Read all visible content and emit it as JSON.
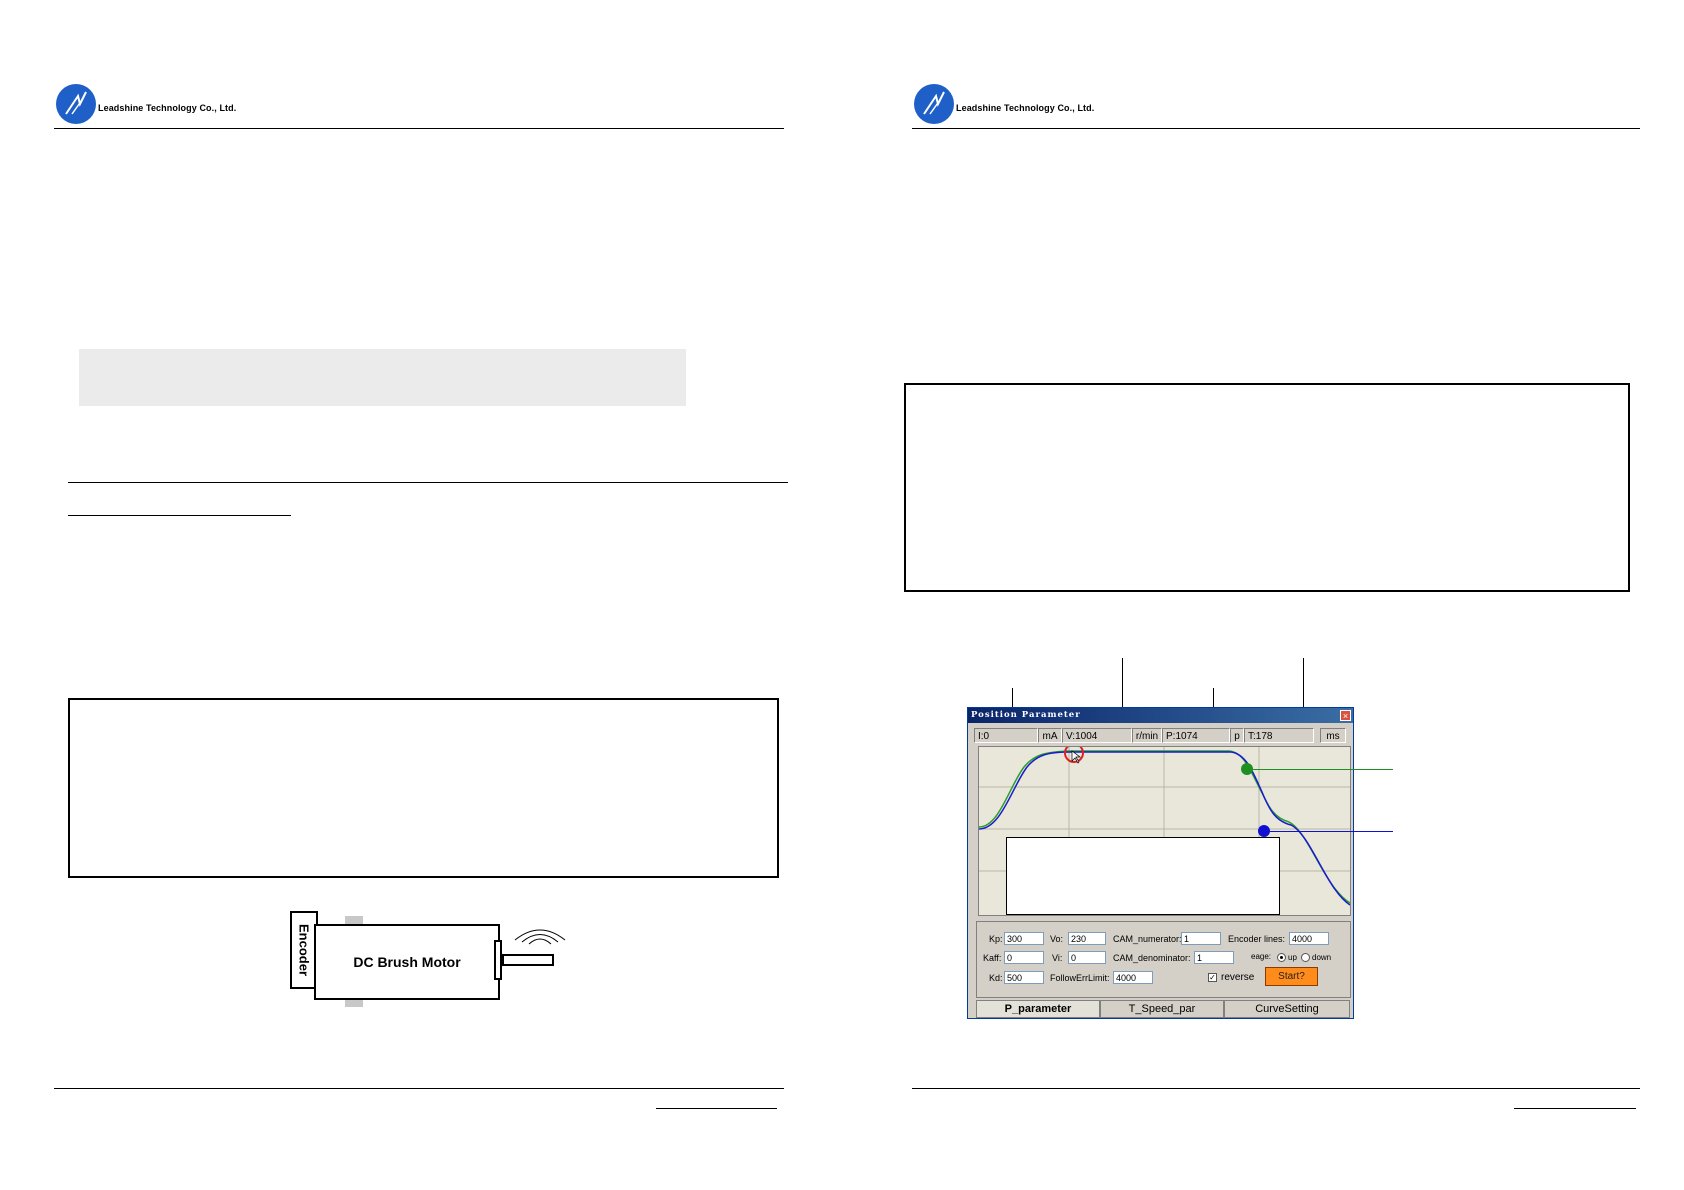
{
  "header": {
    "company_left": "Leadshine Technology Co., Ltd.",
    "company_right": "Leadshine Technology Co., Ltd."
  },
  "motor_diagram": {
    "encoder_label": "Encoder",
    "motor_label": "DC Brush Motor"
  },
  "position_window": {
    "title": "Position Parameter",
    "readouts": {
      "current": "I:0",
      "current_unit": "mA",
      "velocity": "V:1004",
      "velocity_unit": "r/min",
      "position": "P:1074",
      "position_unit": "p",
      "time": "T:178",
      "time_unit": "ms"
    },
    "params": {
      "kp_label": "Kp:",
      "kp_value": "300",
      "kaff_label": "Kaff:",
      "kaff_value": "0",
      "kd_label": "Kd:",
      "kd_value": "500",
      "vo_label": "Vo:",
      "vo_value": "230",
      "vi_label": "Vi:",
      "vi_value": "0",
      "follow_label": "FollowErrLimit:",
      "follow_value": "4000",
      "cam_num_label": "CAM_numerator:",
      "cam_num_value": "1",
      "cam_den_label": "CAM_denominator:",
      "cam_den_value": "1",
      "encoder_label": "Encoder lines:",
      "encoder_value": "4000",
      "edge_label": "eage:",
      "edge_up": "up",
      "edge_down": "down",
      "reverse_label": "reverse",
      "start_label": "Start?"
    },
    "tabs": [
      "P_parameter",
      "T_Speed_par",
      "CurveSetting"
    ],
    "colors": {
      "target_curve": "#2aa02a",
      "actual_curve": "#1a1ad0"
    }
  }
}
